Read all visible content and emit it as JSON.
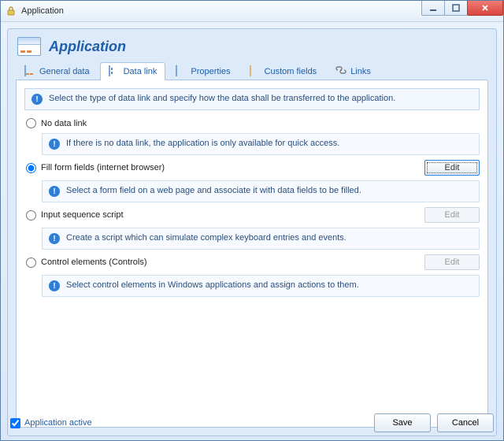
{
  "window": {
    "title": "Application"
  },
  "header": {
    "title": "Application"
  },
  "tabs": [
    {
      "id": "general",
      "label": "General data"
    },
    {
      "id": "datalink",
      "label": "Data link"
    },
    {
      "id": "properties",
      "label": "Properties"
    },
    {
      "id": "custom",
      "label": "Custom fields"
    },
    {
      "id": "links",
      "label": "Links"
    }
  ],
  "info": "Select the type of data link and specify how the data shall be transferred to the application.",
  "options": [
    {
      "id": "none",
      "label": "No data link",
      "selected": false,
      "edit": null,
      "desc": "If there is no data link, the application is only available for quick access."
    },
    {
      "id": "form",
      "label": "Fill form fields (internet browser)",
      "selected": true,
      "edit": "Edit",
      "edit_enabled": true,
      "desc": "Select a form field on a web page and associate it with data fields to be filled."
    },
    {
      "id": "script",
      "label": "Input sequence script",
      "selected": false,
      "edit": "Edit",
      "edit_enabled": false,
      "desc": "Create a script which can simulate complex keyboard entries and events."
    },
    {
      "id": "controls",
      "label": "Control elements (Controls)",
      "selected": false,
      "edit": "Edit",
      "edit_enabled": false,
      "desc": "Select control elements in Windows applications and assign actions to them."
    }
  ],
  "footer": {
    "active_label": "Application active",
    "active_checked": true,
    "save": "Save",
    "cancel": "Cancel"
  }
}
